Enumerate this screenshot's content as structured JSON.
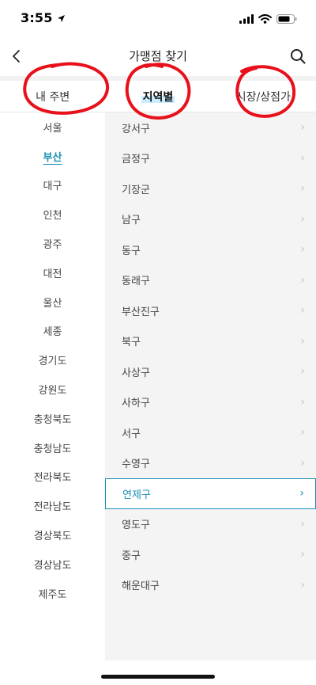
{
  "status_bar": {
    "time": "3:55"
  },
  "header": {
    "title": "가맹점 찾기"
  },
  "tabs": [
    {
      "label": "내 주변",
      "active": false
    },
    {
      "label": "지역별",
      "active": true
    },
    {
      "label": "시장/상점가",
      "active": false
    }
  ],
  "regions": [
    {
      "label": "서울",
      "active": false
    },
    {
      "label": "부산",
      "active": true
    },
    {
      "label": "대구",
      "active": false
    },
    {
      "label": "인천",
      "active": false
    },
    {
      "label": "광주",
      "active": false
    },
    {
      "label": "대전",
      "active": false
    },
    {
      "label": "울산",
      "active": false
    },
    {
      "label": "세종",
      "active": false
    },
    {
      "label": "경기도",
      "active": false
    },
    {
      "label": "강원도",
      "active": false
    },
    {
      "label": "충청북도",
      "active": false
    },
    {
      "label": "충청남도",
      "active": false
    },
    {
      "label": "전라북도",
      "active": false
    },
    {
      "label": "전라남도",
      "active": false
    },
    {
      "label": "경상북도",
      "active": false
    },
    {
      "label": "경상남도",
      "active": false
    },
    {
      "label": "제주도",
      "active": false
    }
  ],
  "districts": [
    {
      "label": "강서구",
      "active": false
    },
    {
      "label": "금정구",
      "active": false
    },
    {
      "label": "기장군",
      "active": false
    },
    {
      "label": "남구",
      "active": false
    },
    {
      "label": "동구",
      "active": false
    },
    {
      "label": "동래구",
      "active": false
    },
    {
      "label": "부산진구",
      "active": false
    },
    {
      "label": "북구",
      "active": false
    },
    {
      "label": "사상구",
      "active": false
    },
    {
      "label": "사하구",
      "active": false
    },
    {
      "label": "서구",
      "active": false
    },
    {
      "label": "수영구",
      "active": false
    },
    {
      "label": "연제구",
      "active": true
    },
    {
      "label": "영도구",
      "active": false
    },
    {
      "label": "중구",
      "active": false
    },
    {
      "label": "해운대구",
      "active": false
    }
  ],
  "colors": {
    "accent": "#1a8fb8",
    "tab_highlight": "#c9ecff",
    "annotation": "#e8101a",
    "panel_bg": "#f4f4f4"
  },
  "icons": {
    "back": "chevron-left-icon",
    "search": "search-icon",
    "row": "chevron-right-icon"
  }
}
